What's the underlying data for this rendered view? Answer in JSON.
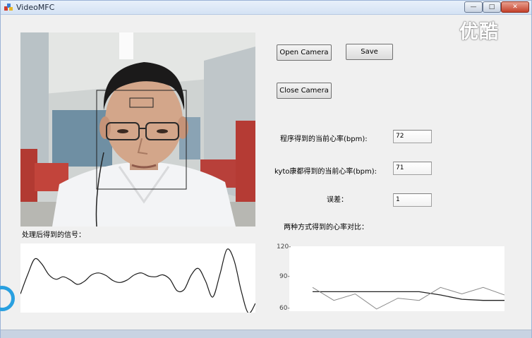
{
  "window": {
    "title": "VideoMFC",
    "min_glyph": "—",
    "max_glyph": "□",
    "close_glyph": "✕"
  },
  "watermark": "优酷",
  "buttons": {
    "open_camera": "Open Camera",
    "save": "Save",
    "close_camera": "Close Camera"
  },
  "readings": {
    "program_label": "程序得到的当前心率(bpm):",
    "program_value": "72",
    "kyto_label": "kyto康都得到的当前心率(bpm):",
    "kyto_value": "71",
    "error_label": "误差：",
    "error_value": "1"
  },
  "signal_panel": {
    "title": "处理后得到的信号："
  },
  "compare_panel": {
    "title": "两种方式得到的心率对比："
  },
  "colors": {
    "signal": "#1a1a1a",
    "program_line": "#222222",
    "kyto_line": "#8a8a8a"
  },
  "chart_data": [
    {
      "type": "line",
      "title": "处理后得到的信号：",
      "x": [
        0,
        1,
        2,
        3,
        4,
        5,
        6,
        7,
        8,
        9,
        10,
        11,
        12,
        13,
        14,
        15,
        16,
        17,
        18,
        19,
        20,
        21,
        22,
        23,
        24,
        25,
        26,
        27,
        28,
        29,
        30,
        31,
        32,
        33
      ],
      "series": [
        {
          "values": [
            0.25,
            0.55,
            0.8,
            0.72,
            0.55,
            0.48,
            0.52,
            0.47,
            0.4,
            0.45,
            0.55,
            0.58,
            0.54,
            0.46,
            0.43,
            0.47,
            0.55,
            0.58,
            0.53,
            0.52,
            0.55,
            0.48,
            0.3,
            0.32,
            0.55,
            0.65,
            0.45,
            0.2,
            0.55,
            0.95,
            0.78,
            0.3,
            -0.05,
            0.1
          ]
        }
      ]
    },
    {
      "type": "line",
      "title": "两种方式得到的心率对比：",
      "ylim": [
        60,
        120
      ],
      "yticks": [
        "120-",
        "90-",
        "60-"
      ],
      "x": [
        0,
        1,
        2,
        3,
        4,
        5,
        6,
        7,
        8,
        9
      ],
      "series": [
        {
          "values": [
            78,
            78,
            78,
            78,
            78,
            78,
            75,
            71,
            70,
            70
          ]
        },
        {
          "values": [
            82,
            70,
            76,
            62,
            72,
            70,
            82,
            76,
            82,
            75
          ]
        }
      ]
    }
  ]
}
